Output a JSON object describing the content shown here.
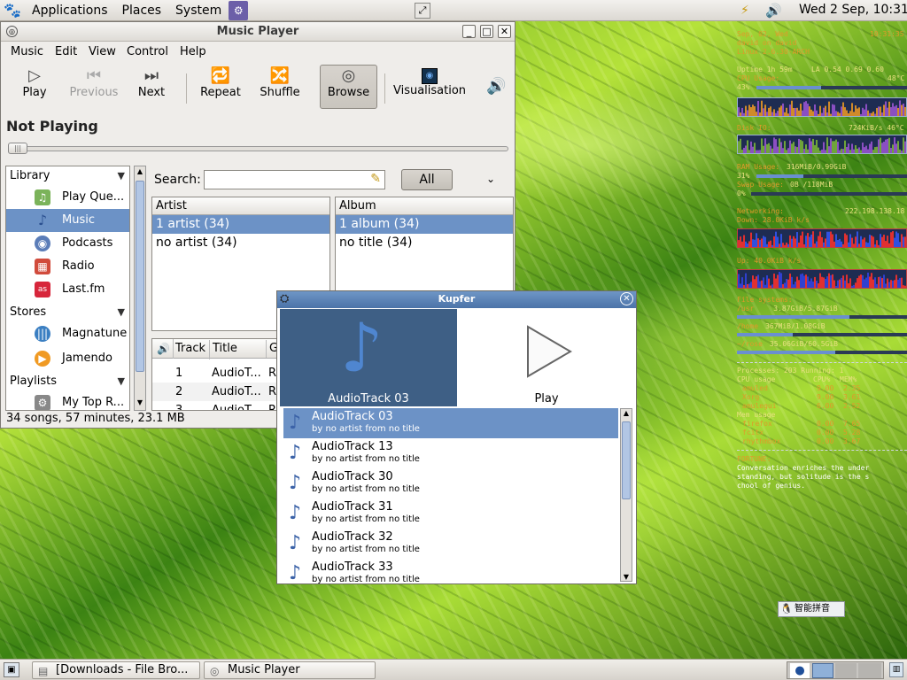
{
  "top_panel": {
    "menus": [
      "Applications",
      "Places",
      "System"
    ],
    "clock": "Wed  2 Sep, 10:31"
  },
  "music_player": {
    "title": "Music Player",
    "menus": [
      "Music",
      "Edit",
      "View",
      "Control",
      "Help"
    ],
    "toolbar": {
      "play": "Play",
      "previous": "Previous",
      "next": "Next",
      "repeat": "Repeat",
      "shuffle": "Shuffle",
      "browse": "Browse",
      "visualisation": "Visualisation"
    },
    "now_playing": "Not Playing",
    "sidebar": {
      "library_header": "Library",
      "library_items": [
        "Play Que...",
        "Music",
        "Podcasts",
        "Radio",
        "Last.fm"
      ],
      "stores_header": "Stores",
      "stores_items": [
        "Magnatune",
        "Jamendo"
      ],
      "playlists_header": "Playlists",
      "playlists_items": [
        "My Top R..."
      ]
    },
    "search_label": "Search:",
    "search_value": "",
    "all_button": "All",
    "artist_header": "Artist",
    "artist_rows": [
      "1 artist (34)",
      "no artist (34)"
    ],
    "album_header": "Album",
    "album_rows": [
      "1 album (34)",
      "no title (34)"
    ],
    "track_headers": {
      "track": "Track",
      "title": "Title",
      "g": "G"
    },
    "tracks": [
      {
        "num": "1",
        "title": "AudioT...",
        "extra": "Re"
      },
      {
        "num": "2",
        "title": "AudioT...",
        "extra": "Re"
      },
      {
        "num": "3",
        "title": "AudioT...",
        "extra": "Re"
      }
    ],
    "status": "34 songs, 57 minutes, 23.1 MB"
  },
  "kupfer": {
    "title": "Kupfer",
    "object_label": "AudioTrack 03",
    "action_label": "Play",
    "items": [
      {
        "name": "AudioTrack 03",
        "sub": "by no artist from no title"
      },
      {
        "name": "AudioTrack 13",
        "sub": "by no artist from no title"
      },
      {
        "name": "AudioTrack 30",
        "sub": "by no artist from no title"
      },
      {
        "name": "AudioTrack 31",
        "sub": "by no artist from no title"
      },
      {
        "name": "AudioTrack 32",
        "sub": "by no artist from no title"
      },
      {
        "name": "AudioTrack 33",
        "sub": "by no artist from no title"
      }
    ]
  },
  "conky": {
    "date": "Sep, 02, Wed",
    "time": "10:31:35",
    "user_line": "david on david",
    "kernel": "Linux 2.6.30-ARCH",
    "uptime": "Uptime 1h 59m",
    "load": "LA 0.54 0.69 0.60",
    "cpu_label": "CPU Usage:",
    "cpu_temp": "48°C",
    "cpu_pct": "43%",
    "cpu_level": 43,
    "disk_label": "Disk IO:",
    "disk_value": "724KiB/s 46°C",
    "ram_label": "RAM Usage:",
    "ram_value": "316MiB/0.99GiB",
    "ram_pct": "31%",
    "ram_level": 31,
    "swap_label": "Swap Usage:",
    "swap_value": "0B  /118MiB",
    "swap_pct": "0%",
    "swap_level": 0,
    "net_label": "Networking:",
    "net_ip": "222.198.138.18",
    "down_label": "Down: 28.0KiB k/s",
    "up_label": "Up: 40.0KiB k/s",
    "fs_label": "File systems:",
    "fs": [
      {
        "mount": "/usr",
        "value": "3.87GiB/5.87GiB",
        "level": 66
      },
      {
        "mount": "/home",
        "value": "367MiB/1.08GiB",
        "level": 33
      },
      {
        "mount": "~/rose",
        "value": "35.06GiB/60.5GiB",
        "level": 58
      }
    ],
    "processes": "Processes: 203  Running: 1",
    "cpu_usage_header": "CPU usage",
    "cpu_col": "CPU%",
    "mem_col": "MEM%",
    "cpu_procs": [
      {
        "name": "amuled",
        "cpu": "9.00",
        "mem": "2.35"
      },
      {
        "name": "Xorg",
        "cpu": "9.00",
        "mem": "3.61"
      },
      {
        "name": "amulegui",
        "cpu": "6.00",
        "mem": "2.52"
      }
    ],
    "mem_usage_header": "Mem usage",
    "mem_procs": [
      {
        "name": "firefox",
        "cpu": "0.00",
        "mem": "7.65"
      },
      {
        "name": "fcitx",
        "cpu": "0.00",
        "mem": "5.28"
      },
      {
        "name": "rhythmbox",
        "cpu": "0.00",
        "mem": "3.67"
      }
    ],
    "fortune_label": "FORTUNE:",
    "fortune_text": [
      "Conversation enriches the under",
      "standing, but solitude is the s",
      "chool of genius."
    ]
  },
  "ime": "智能拼音",
  "taskbar": [
    "[Downloads - File Bro...",
    "Music Player"
  ]
}
